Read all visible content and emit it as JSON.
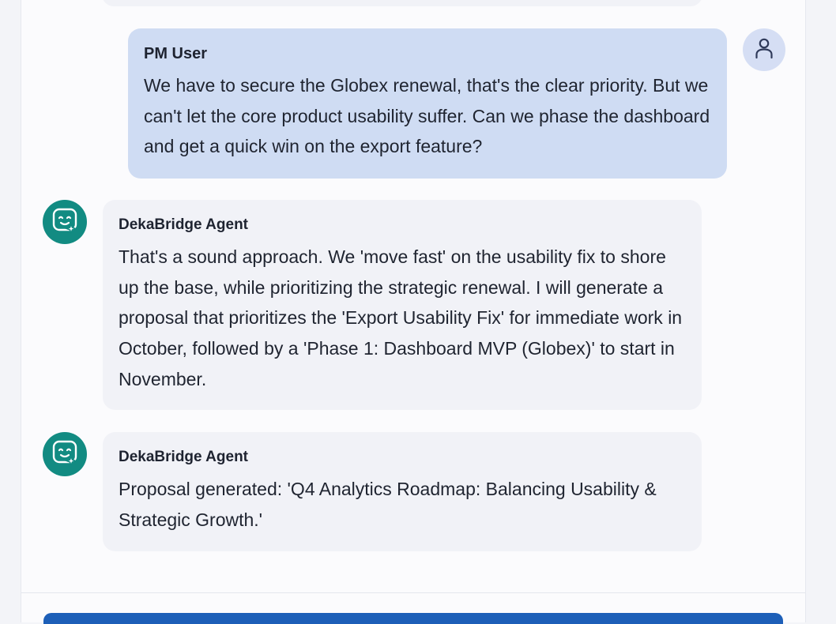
{
  "messages": [
    {
      "role": "user",
      "sender": "PM User",
      "text": "We have to secure the Globex renewal, that's the clear priority. But we can't let the core product usability suffer. Can we phase the dashboard and get a quick win on the export feature?",
      "avatar_icon": "user-icon"
    },
    {
      "role": "agent",
      "sender": "DekaBridge Agent",
      "text": "That's a sound approach. We 'move fast' on the usability fix to shore up the base, while prioritizing the strategic renewal. I will generate a proposal that prioritizes the 'Export Usability Fix' for immediate work in October, followed by a 'Phase 1: Dashboard MVP (Globex)' to start in November.",
      "avatar_icon": "agent-sparkle-icon"
    },
    {
      "role": "agent",
      "sender": "DekaBridge Agent",
      "text": "Proposal generated: 'Q4 Analytics Roadmap: Balancing Usability & Strategic Growth.'",
      "avatar_icon": "agent-sparkle-icon"
    }
  ],
  "colors": {
    "user_bubble": "#cfdcf3",
    "agent_bubble": "#f1f2f7",
    "agent_avatar": "#128b82",
    "user_avatar": "#d5def4",
    "input_accent": "#1d5fb8"
  }
}
